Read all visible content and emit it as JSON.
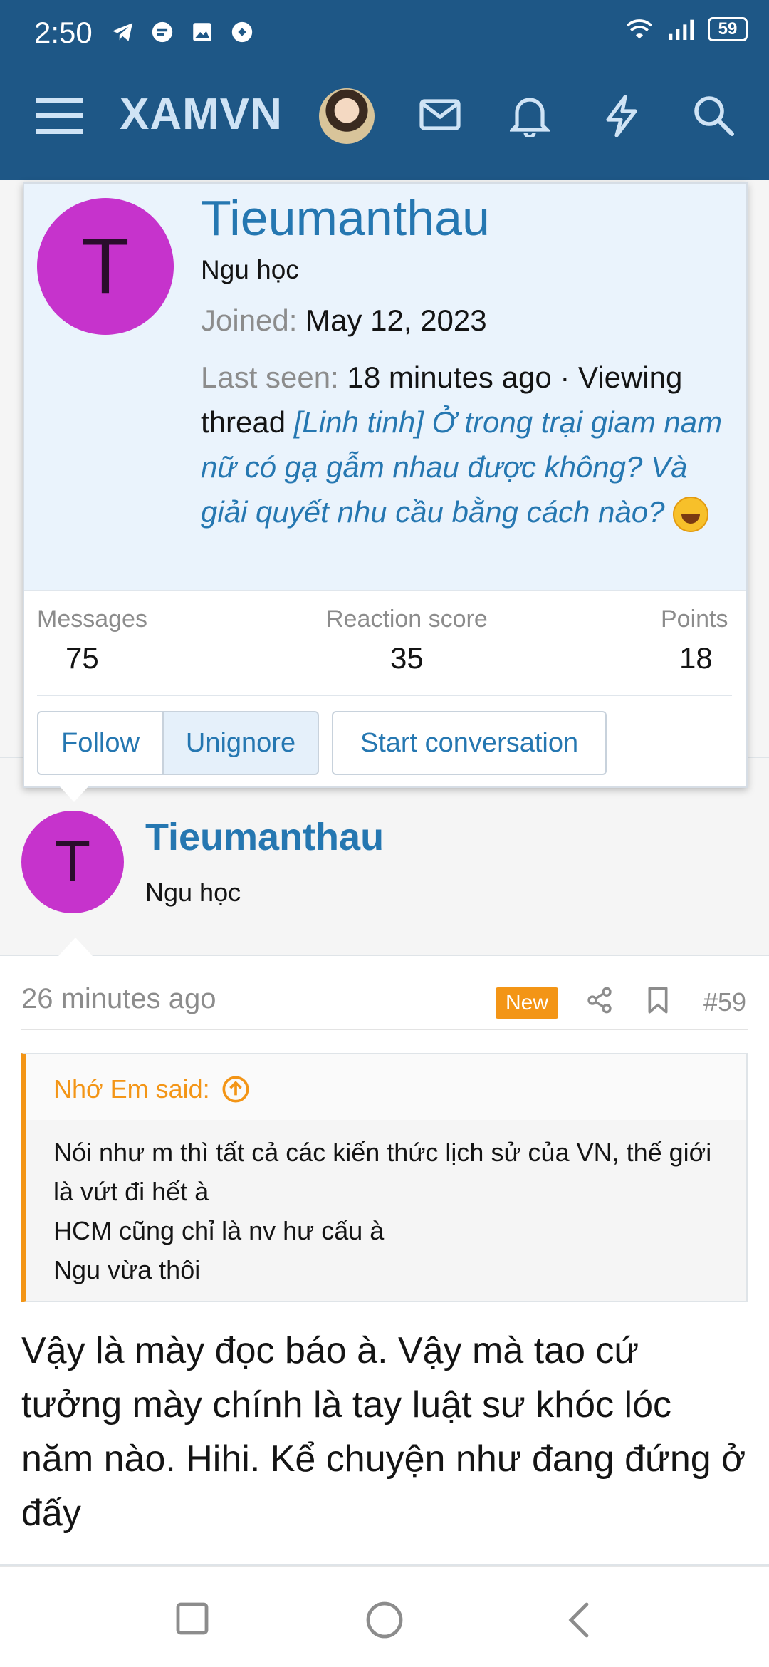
{
  "status_bar": {
    "time": "2:50",
    "battery": "59",
    "left_icons": [
      "telegram-icon",
      "messenger-icon",
      "gallery-icon",
      "chat-bubble-icon"
    ],
    "right_icons": [
      "wifi-icon",
      "signal-icon",
      "battery-icon"
    ]
  },
  "nav": {
    "brand": "XAMVN",
    "icons": [
      "menu-icon",
      "user-avatar",
      "mail-icon",
      "bell-icon",
      "lightning-icon",
      "search-icon"
    ],
    "bar_color": "#1e5786"
  },
  "member_card": {
    "avatar_letter": "T",
    "avatar_color": "#c633cc",
    "username": "Tieumanthau",
    "user_title": "Ngu học",
    "joined_label": "Joined:",
    "joined_value": "May 12, 2023",
    "last_seen_label": "Last seen:",
    "last_seen_value": "18 minutes ago · Viewing thread",
    "thread_title": "[Linh tinh] Ở trong trại giam nam nữ có gạ gẫm nhau được không? Và giải quyết nhu cầu bằng cách nào?",
    "stats": {
      "messages_label": "Messages",
      "messages_value": "75",
      "reaction_label": "Reaction score",
      "reaction_value": "35",
      "points_label": "Points",
      "points_value": "18"
    },
    "buttons": {
      "follow": "Follow",
      "unignore": "Unignore",
      "start_conversation": "Start conversation"
    }
  },
  "post": {
    "avatar_letter": "T",
    "username": "Tieumanthau",
    "user_title": "Ngu học",
    "time": "26 minutes ago",
    "badge": "New",
    "number": "#59",
    "quote": {
      "author": "Nhớ Em said:",
      "lines": [
        "Nói như m thì tất cả các kiến thức lịch sử của VN, thế giới là vứt đi hết à",
        "HCM cũng chỉ là nv hư cấu à",
        "Ngu vừa thôi"
      ]
    },
    "message": "Vậy là mày đọc báo à. Vậy mà tao cứ tưởng mày chính là tay luật sư khóc lóc năm nào. Hihi. Kể chuyện như đang đứng ở đấy"
  },
  "colors": {
    "link": "#2577b1",
    "accent": "#f39516",
    "muted": "#8c8c8c"
  }
}
